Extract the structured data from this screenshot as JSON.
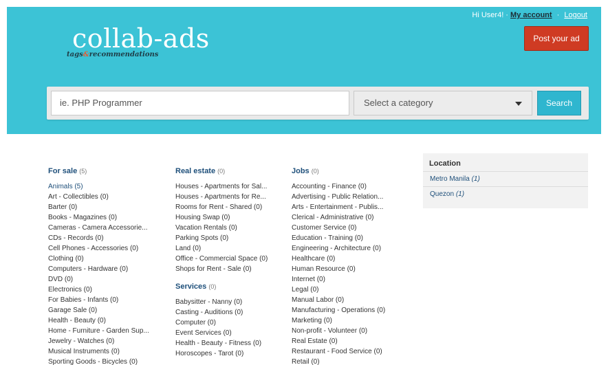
{
  "header": {
    "greeting": "Hi User4! ·",
    "my_account": "My account",
    "sep": "·",
    "logout": "Logout",
    "logo_main": "collab-ads",
    "logo_tags": "tags",
    "logo_amp": "&",
    "logo_rec": "recommendations",
    "post_ad": "Post your ad",
    "bg_color": "#3cc3d6",
    "post_color": "#cf3b23"
  },
  "search": {
    "placeholder": "ie. PHP Programmer",
    "category": "Select a category",
    "button": "Search"
  },
  "columns": [
    {
      "title": "For sale",
      "count": "(5)",
      "items": [
        "Animals (5)",
        "Art - Collectibles (0)",
        "Barter (0)",
        "Books - Magazines (0)",
        "Cameras - Camera Accessorie...",
        "CDs - Records (0)",
        "Cell Phones - Accessories (0)",
        "Clothing (0)",
        "Computers - Hardware (0)",
        "DVD (0)",
        "Electronics (0)",
        "For Babies - Infants (0)",
        "Garage Sale (0)",
        "Health - Beauty (0)",
        "Home - Furniture - Garden Sup...",
        "Jewelry - Watches (0)",
        "Musical Instruments (0)",
        "Sporting Goods - Bicycles (0)"
      ]
    },
    {
      "title": "Real estate",
      "count": "(0)",
      "items": [
        "Houses - Apartments for Sal...",
        "Houses - Apartments for Re...",
        "Rooms for Rent - Shared (0)",
        "Housing Swap (0)",
        "Vacation Rentals (0)",
        "Parking Spots (0)",
        "Land (0)",
        "Office - Commercial Space (0)",
        "Shops for Rent - Sale (0)"
      ]
    },
    {
      "title": "Services",
      "count": "(0)",
      "items": [
        "Babysitter - Nanny (0)",
        "Casting - Auditions (0)",
        "Computer (0)",
        "Event Services (0)",
        "Health - Beauty - Fitness (0)",
        "Horoscopes - Tarot (0)"
      ]
    },
    {
      "title": "Jobs",
      "count": "(0)",
      "items": [
        "Accounting - Finance (0)",
        "Advertising - Public Relation...",
        "Arts - Entertainment - Publis...",
        "Clerical - Administrative (0)",
        "Customer Service (0)",
        "Education - Training (0)",
        "Engineering - Architecture (0)",
        "Healthcare (0)",
        "Human Resource (0)",
        "Internet (0)",
        "Legal (0)",
        "Manual Labor (0)",
        "Manufacturing - Operations (0)",
        "Marketing (0)",
        "Non-profit - Volunteer (0)",
        "Real Estate (0)",
        "Restaurant - Food Service (0)",
        "Retail (0)"
      ]
    }
  ],
  "location": {
    "title": "Location",
    "items": [
      {
        "name": "Metro Manila",
        "count": "(1)"
      },
      {
        "name": "Quezon",
        "count": "(1)"
      }
    ]
  }
}
